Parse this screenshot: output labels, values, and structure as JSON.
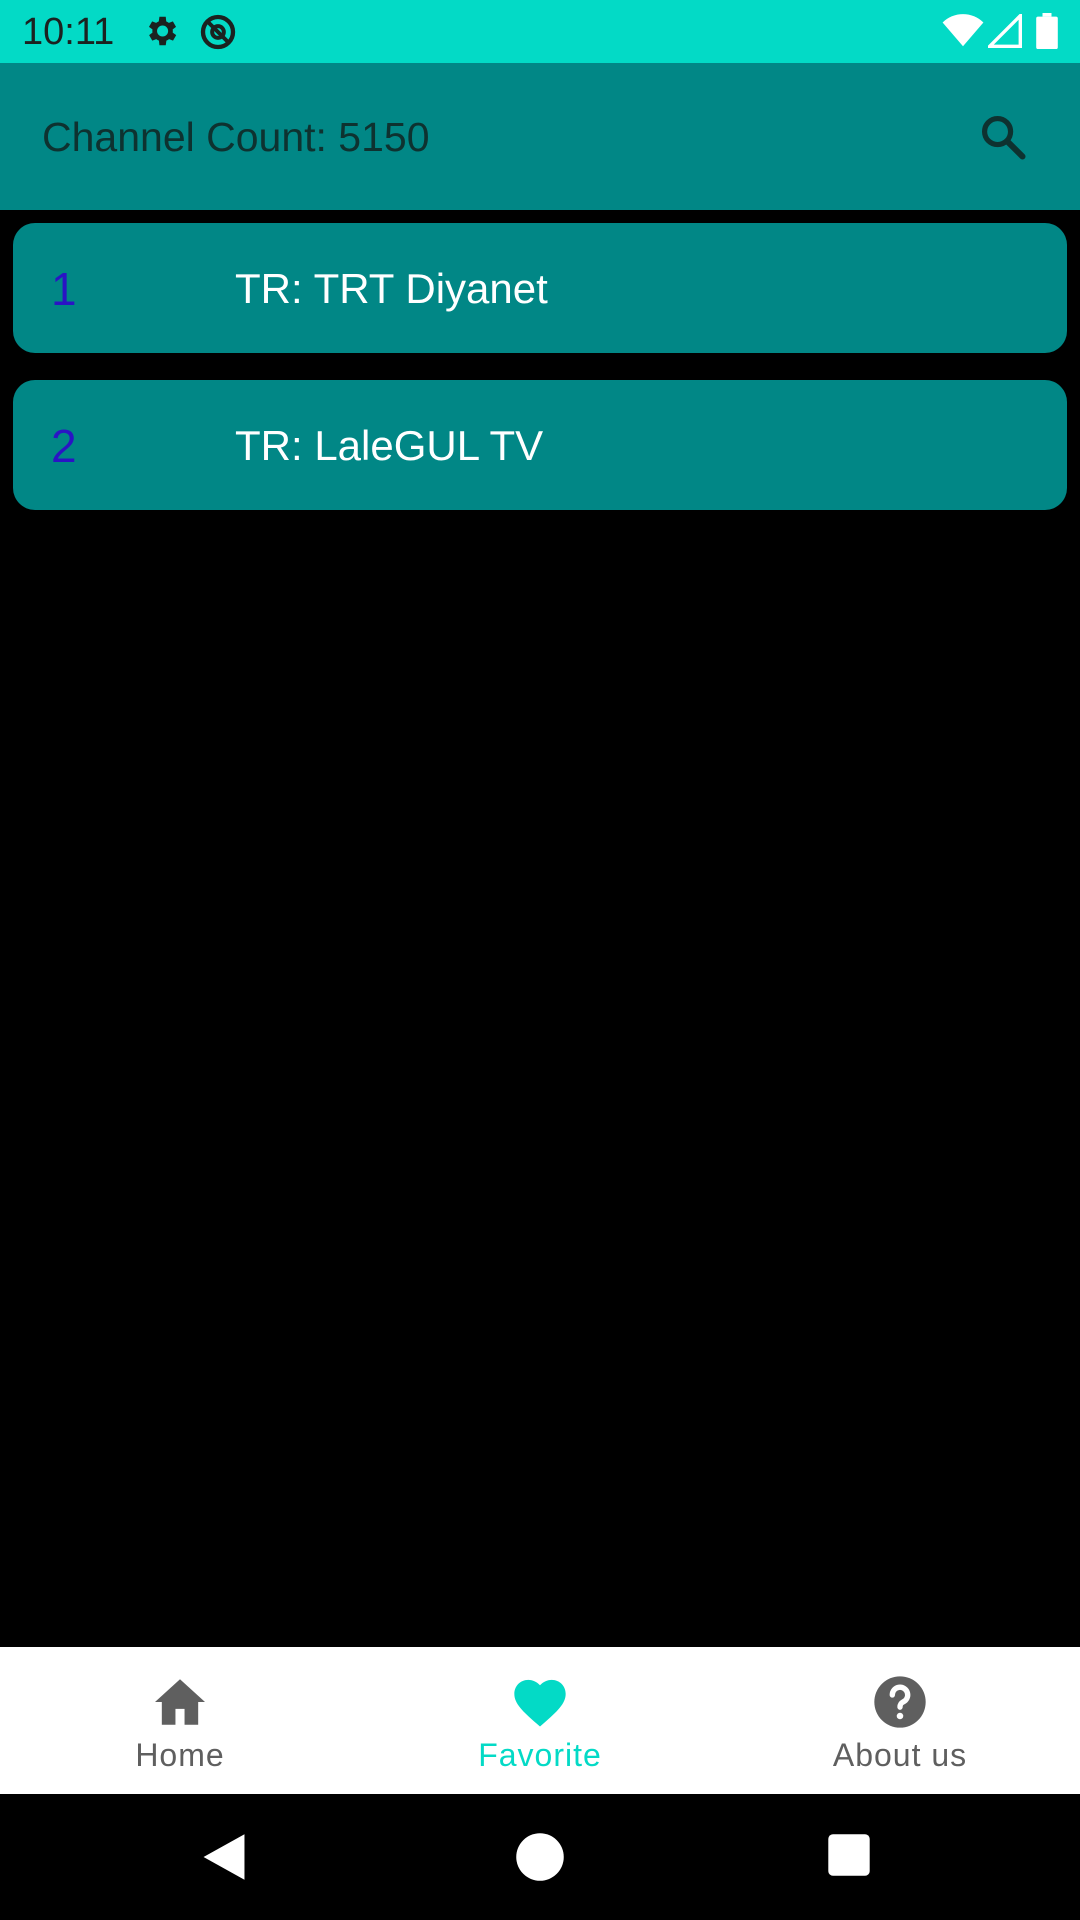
{
  "status_bar": {
    "time": "10:11",
    "icons": [
      "gear-icon",
      "sync-disabled-icon",
      "wifi-icon",
      "signal-icon",
      "battery-icon"
    ]
  },
  "app_bar": {
    "title": "Channel Count: 5150",
    "search_icon": "search-icon"
  },
  "channels": [
    {
      "number": "1",
      "name": "TR: TRT Diyanet"
    },
    {
      "number": "2",
      "name": "TR: LaleGUL TV"
    }
  ],
  "bottom_nav": {
    "items": [
      {
        "label": "Home",
        "icon": "home-icon",
        "active": false
      },
      {
        "label": "Favorite",
        "icon": "heart-icon",
        "active": true
      },
      {
        "label": "About us",
        "icon": "help-icon",
        "active": false
      }
    ]
  },
  "system_nav": [
    "back-icon",
    "home-circle-icon",
    "recents-icon"
  ],
  "colors": {
    "status_bar": "#03DAC6",
    "app_bar": "#018786",
    "accent": "#03DAC6",
    "channel_number": "#2a14c4",
    "background": "#000000"
  }
}
